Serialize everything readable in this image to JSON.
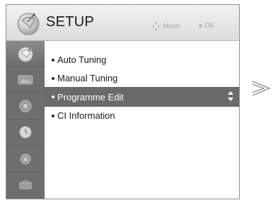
{
  "header": {
    "title": "SETUP",
    "hints": {
      "move": "Move",
      "ok": "OK"
    }
  },
  "sidebar": {
    "items": [
      {
        "name": "setup",
        "icon": "satellite-dish-icon",
        "active": true
      },
      {
        "name": "picture",
        "icon": "picture-icon",
        "active": false
      },
      {
        "name": "audio",
        "icon": "speaker-icon",
        "active": false
      },
      {
        "name": "time",
        "icon": "clock-icon",
        "active": false
      },
      {
        "name": "lock",
        "icon": "lock-icon",
        "active": false
      },
      {
        "name": "option",
        "icon": "option-icon",
        "active": false
      }
    ]
  },
  "menu": {
    "items": [
      {
        "label": "Auto Tuning"
      },
      {
        "label": "Manual Tuning"
      },
      {
        "label": "Programme Edit",
        "selected": true
      },
      {
        "label": "CI Information"
      }
    ]
  },
  "colors": {
    "sidebar": "#6e6e6e",
    "highlight": "#6a6a6a",
    "header": "#e6e6e6"
  }
}
